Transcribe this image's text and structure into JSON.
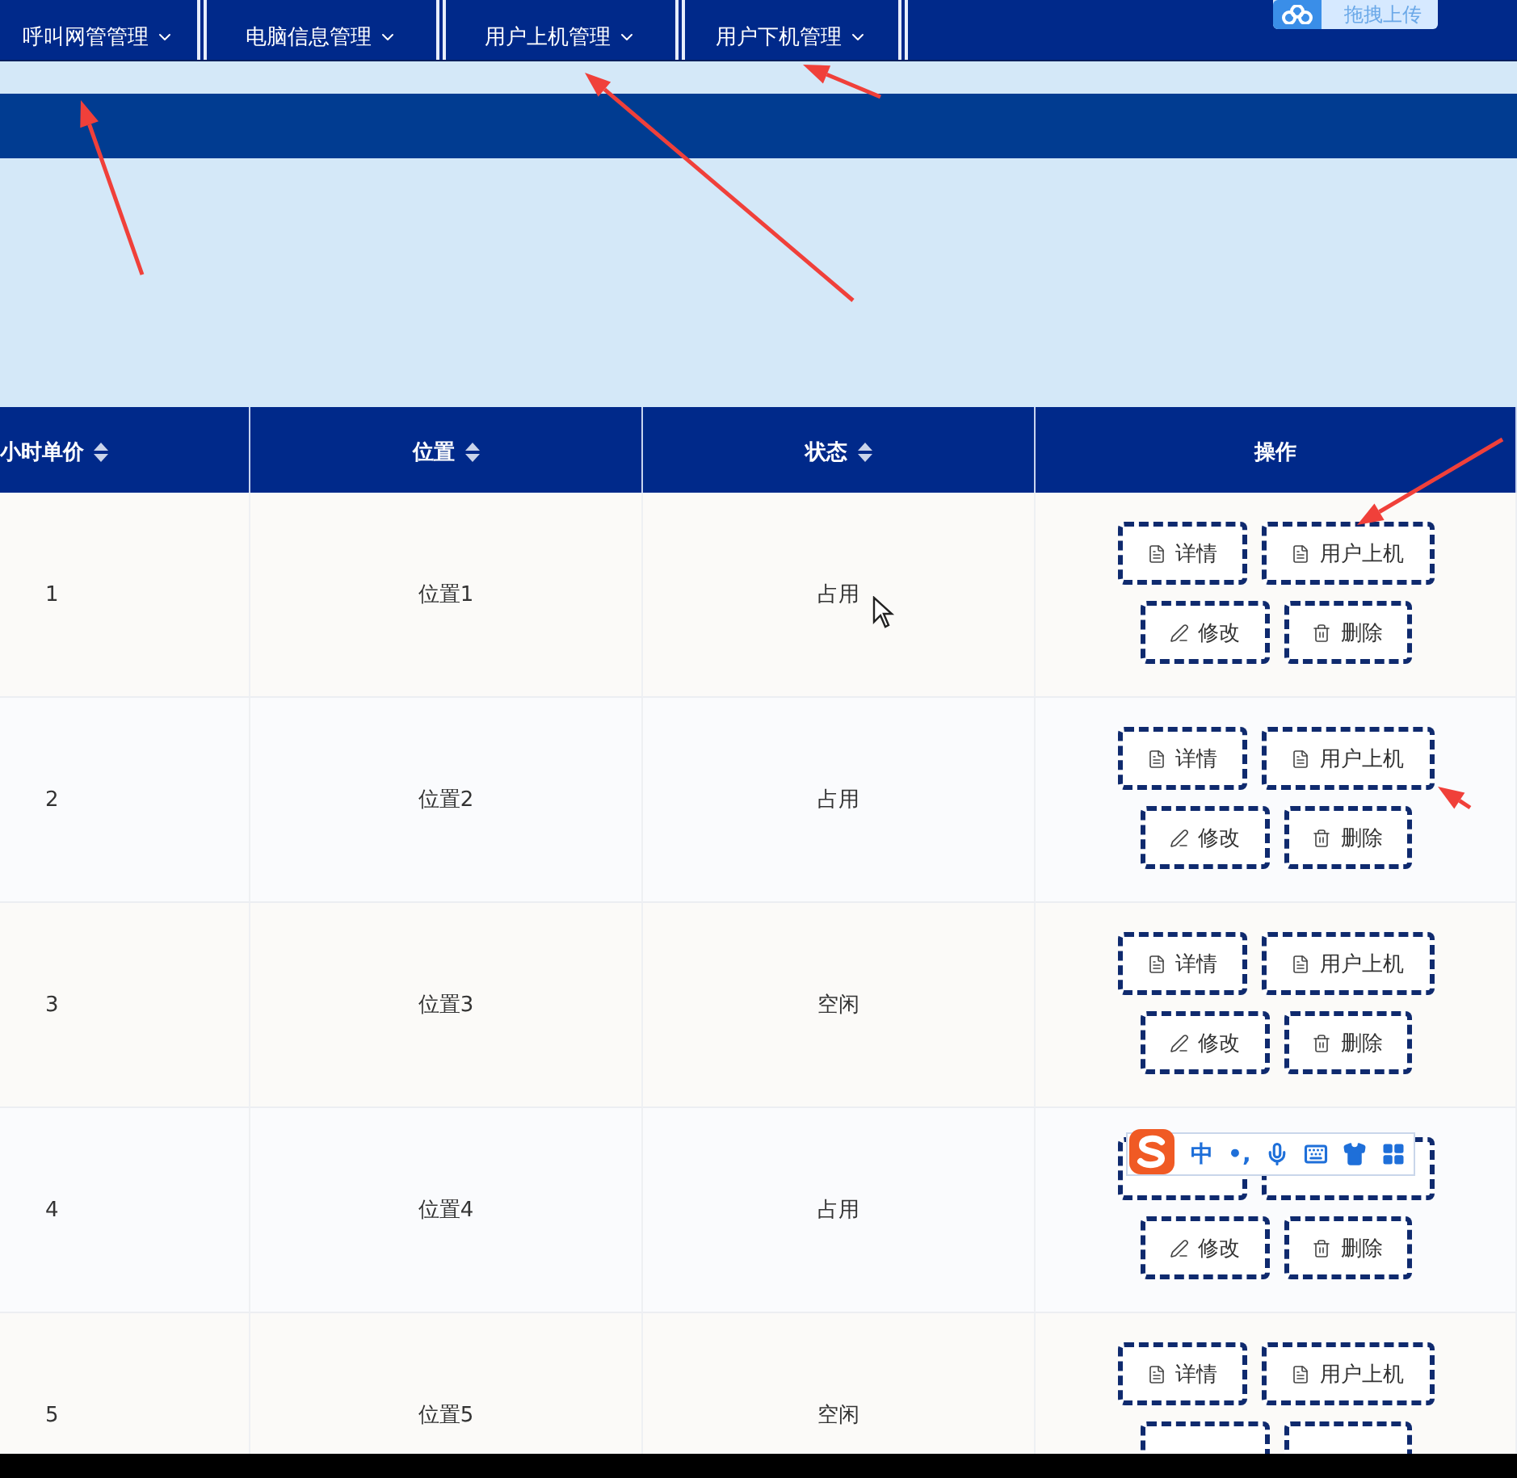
{
  "nav": {
    "items": [
      {
        "label": "呼叫网管管理"
      },
      {
        "label": "电脑信息管理"
      },
      {
        "label": "用户上机管理"
      },
      {
        "label": "用户下机管理"
      }
    ],
    "upload_button": {
      "label": "拖拽上传"
    }
  },
  "table": {
    "columns": [
      {
        "label": "小时单价",
        "sortable": true
      },
      {
        "label": "位置",
        "sortable": true
      },
      {
        "label": "状态",
        "sortable": true
      },
      {
        "label": "操作",
        "sortable": false
      }
    ],
    "rows": [
      {
        "cells": [
          "1",
          "位置1",
          "占用"
        ],
        "actions": [
          {
            "kind": "detail",
            "label": "详情"
          },
          {
            "kind": "login",
            "label": "用户上机"
          },
          {
            "kind": "edit",
            "label": "修改"
          },
          {
            "kind": "delete",
            "label": "删除"
          }
        ]
      },
      {
        "cells": [
          "2",
          "位置2",
          "占用"
        ],
        "actions": [
          {
            "kind": "detail",
            "label": "详情"
          },
          {
            "kind": "login",
            "label": "用户上机"
          },
          {
            "kind": "edit",
            "label": "修改"
          },
          {
            "kind": "delete",
            "label": "删除"
          }
        ]
      },
      {
        "cells": [
          "3",
          "位置3",
          "空闲"
        ],
        "actions": [
          {
            "kind": "detail",
            "label": "详情"
          },
          {
            "kind": "login",
            "label": "用户上机"
          },
          {
            "kind": "edit",
            "label": "修改"
          },
          {
            "kind": "delete",
            "label": "删除"
          }
        ]
      },
      {
        "cells": [
          "4",
          "位置4",
          "占用"
        ],
        "actions": [
          {
            "kind": "detail"
          },
          {
            "kind": "login"
          },
          {
            "kind": "edit",
            "label": "修改"
          },
          {
            "kind": "delete",
            "label": "删除"
          }
        ]
      },
      {
        "cells": [
          "5",
          "位置5",
          "空闲"
        ],
        "actions": [
          {
            "kind": "detail",
            "label": "详情"
          },
          {
            "kind": "login",
            "label": "用户上机"
          },
          {
            "kind": "edit"
          },
          {
            "kind": "delete"
          }
        ]
      }
    ]
  },
  "ime_toolbar": {
    "mode": "中",
    "punctuation": "•,"
  }
}
